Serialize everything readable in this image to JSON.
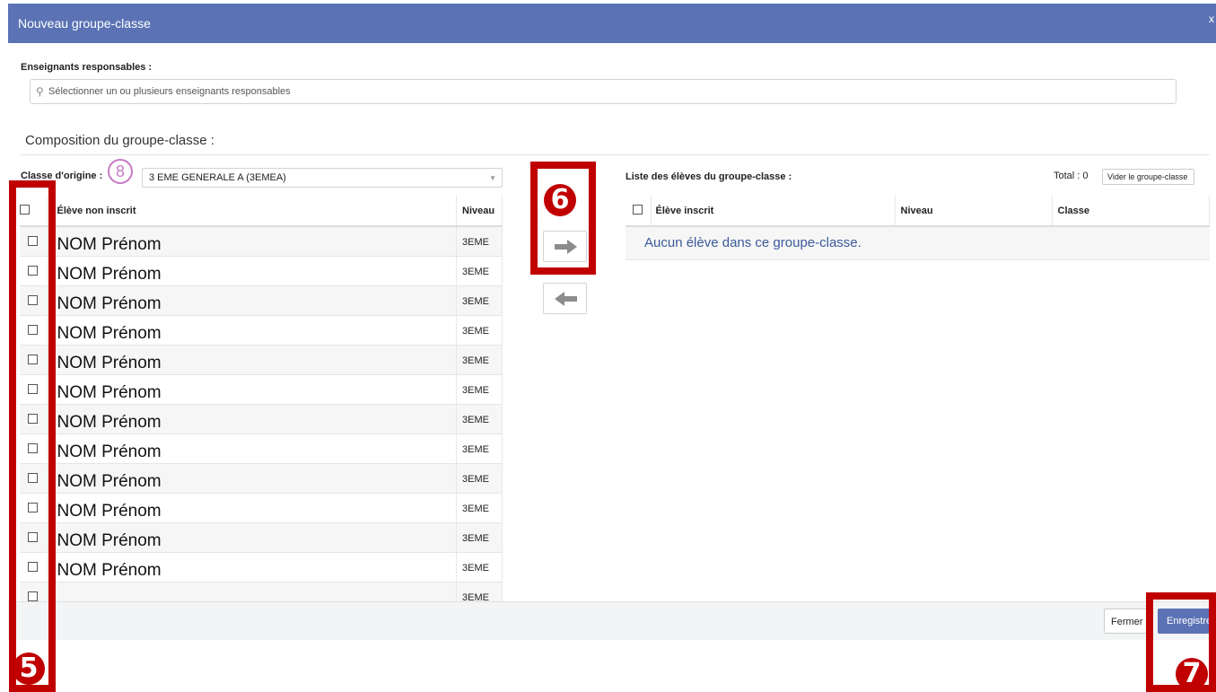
{
  "header": {
    "title": "Nouveau groupe-classe",
    "close": "x"
  },
  "teachers": {
    "label": "Enseignants responsables :",
    "placeholder": "Sélectionner un ou plusieurs enseignants responsables"
  },
  "composition": {
    "title": "Composition du groupe-classe :"
  },
  "origin": {
    "label": "Classe d'origine :",
    "selected": "3 EME GENERALE A (3EMEA)",
    "marker": "8"
  },
  "left_table": {
    "col_student": "Élève non inscrit",
    "col_level": "Niveau",
    "rows": [
      {
        "name": "NOM Prénom",
        "level": "3EME"
      },
      {
        "name": "NOM Prénom",
        "level": "3EME"
      },
      {
        "name": "NOM Prénom",
        "level": "3EME"
      },
      {
        "name": "NOM Prénom",
        "level": "3EME"
      },
      {
        "name": "NOM Prénom",
        "level": "3EME"
      },
      {
        "name": "NOM Prénom",
        "level": "3EME"
      },
      {
        "name": "NOM Prénom",
        "level": "3EME"
      },
      {
        "name": "NOM Prénom",
        "level": "3EME"
      },
      {
        "name": "NOM Prénom",
        "level": "3EME"
      },
      {
        "name": "NOM Prénom",
        "level": "3EME"
      },
      {
        "name": "NOM Prénom",
        "level": "3EME"
      },
      {
        "name": "NOM Prénom",
        "level": "3EME"
      },
      {
        "name": "",
        "level": "3EME"
      }
    ]
  },
  "transfer": {
    "add_icon": "arrow-right-icon",
    "remove_icon": "arrow-left-icon"
  },
  "right_table": {
    "title": "Liste des élèves du groupe-classe :",
    "total": "Total : 0",
    "clear_button": "Vider le groupe-classe",
    "col_student": "Élève inscrit",
    "col_level": "Niveau",
    "col_class": "Classe",
    "empty_message": "Aucun élève dans ce groupe-classe."
  },
  "footer": {
    "close_button": "Fermer",
    "save_button": "Enregistrer"
  },
  "annotations": {
    "badge5": "5",
    "badge6": "6",
    "badge7": "7",
    "color": "#c00000"
  },
  "colors": {
    "header": "#5b73b5",
    "accent": "#c00000",
    "marker8": "#c77ac7"
  }
}
